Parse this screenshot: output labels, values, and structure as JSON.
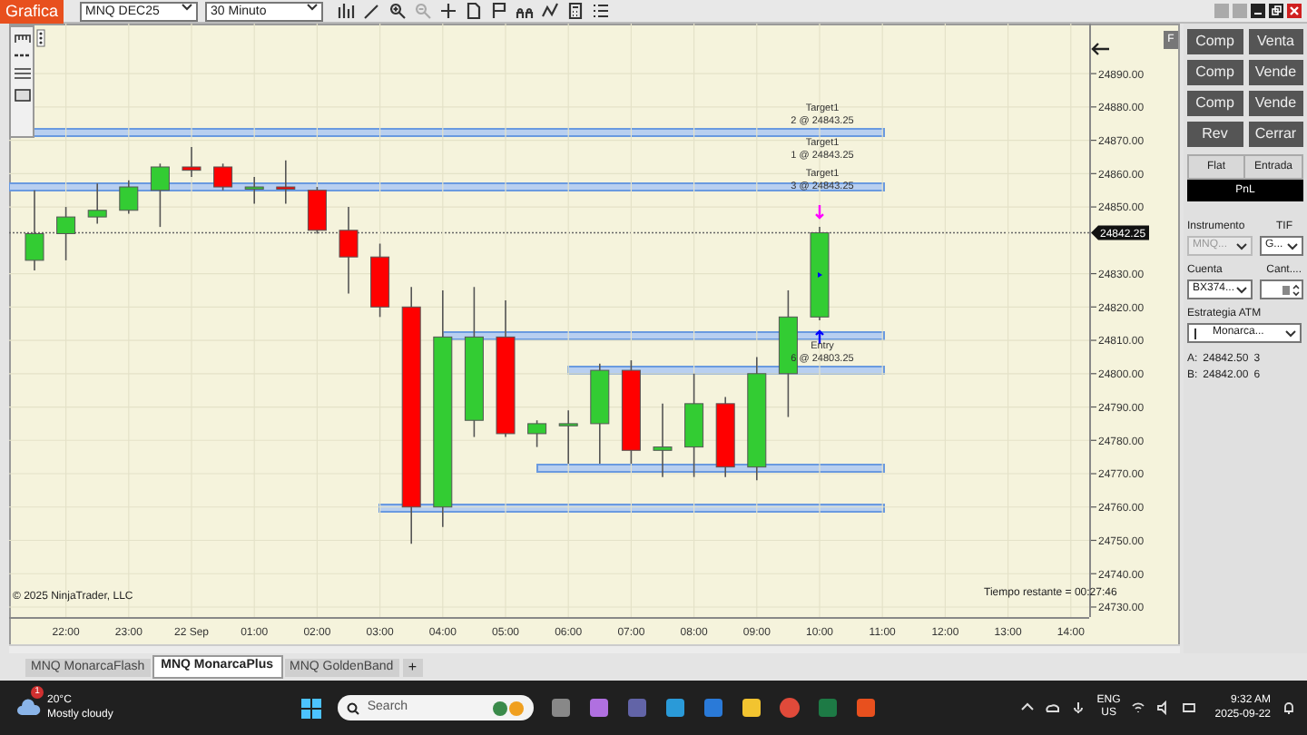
{
  "toolbar": {
    "app_button": "Grafica",
    "instrument": "MNQ DEC25",
    "interval": "30 Minuto"
  },
  "chart": {
    "side_button": "F",
    "copyright": "© 2025 NinjaTrader, LLC",
    "time_remaining": "Tiempo restante = 00:27:46",
    "order_labels": [
      {
        "title": "Target1",
        "detail": "2 @ 24843.25"
      },
      {
        "title": "Target1",
        "detail": "1 @ 24843.25"
      },
      {
        "title": "Target1",
        "detail": "3 @ 24843.25"
      },
      {
        "title": "Entry",
        "detail": "6 @ 24803.25"
      }
    ],
    "chart_data": {
      "type": "candlestick",
      "categories": [
        null,
        "22:00",
        null,
        "23:00",
        null,
        "22 Sep",
        null,
        "01:00",
        null,
        "02:00",
        null,
        "03:00",
        null,
        "04:00",
        null,
        "05:00",
        null,
        "06:00",
        null,
        "07:00",
        null,
        "08:00",
        null,
        "09:00",
        null,
        "10:00",
        null,
        "11:00",
        null,
        "12:00",
        null,
        "13:00",
        null,
        "14:00"
      ],
      "ohlc": [
        [
          24834,
          24855,
          24831,
          24842
        ],
        [
          24842,
          24850,
          24834,
          24847
        ],
        [
          24847,
          24857,
          24845,
          24849
        ],
        [
          24849,
          24858,
          24848,
          24856
        ],
        [
          24855,
          24863,
          24844,
          24862
        ],
        [
          24862,
          24868,
          24859,
          24861
        ],
        [
          24862,
          24863,
          24855,
          24856
        ],
        [
          24856,
          24859,
          24851,
          24856
        ],
        [
          24856,
          24864,
          24851,
          24855.5
        ],
        [
          24855,
          24856,
          24842,
          24843
        ],
        [
          24843,
          24850,
          24824,
          24835
        ],
        [
          24835,
          24839,
          24817,
          24820
        ],
        [
          24820,
          24826,
          24749,
          24760
        ],
        [
          24760,
          24825,
          24754,
          24811
        ],
        [
          24786,
          24826,
          24781,
          24811
        ],
        [
          24811,
          24822,
          24781,
          24782
        ],
        [
          24782,
          24786,
          24778,
          24785
        ],
        [
          24785,
          24789,
          24773,
          24785
        ],
        [
          24785,
          24803,
          24773,
          24801
        ],
        [
          24801,
          24804,
          24773,
          24777
        ],
        [
          24777,
          24791,
          24769,
          24778
        ],
        [
          24778,
          24800,
          24769,
          24791
        ],
        [
          24791,
          24793,
          24769,
          24772
        ],
        [
          24772,
          24805,
          24768,
          24800
        ],
        [
          24800,
          24825,
          24787,
          24817
        ],
        [
          24817,
          24844,
          24816,
          24842.25
        ],
        null,
        null,
        null,
        null,
        null,
        null,
        null,
        null
      ],
      "ylim": [
        24727,
        24905
      ],
      "yticks": [
        {
          "value": 24890,
          "label": "24890.00"
        },
        {
          "value": 24880,
          "label": "24880.00"
        },
        {
          "value": 24870,
          "label": "24870.00"
        },
        {
          "value": 24860,
          "label": "24860.00"
        },
        {
          "value": 24850,
          "label": "24850.00"
        },
        {
          "value": 24830,
          "label": "24830.00"
        },
        {
          "value": 24820,
          "label": "24820.00"
        },
        {
          "value": 24810,
          "label": "24810.00"
        },
        {
          "value": 24800,
          "label": "24800.00"
        },
        {
          "value": 24790,
          "label": "24790.00"
        },
        {
          "value": 24780,
          "label": "24780.00"
        },
        {
          "value": 24770,
          "label": "24770.00"
        },
        {
          "value": 24760,
          "label": "24760.00"
        },
        {
          "value": 24750,
          "label": "24750.00"
        },
        {
          "value": 24740,
          "label": "24740.00"
        },
        {
          "value": 24730,
          "label": "24730.00"
        }
      ],
      "grid": true
    },
    "price_tag": "24842.25"
  },
  "order_panel": {
    "buttons": [
      {
        "label": "Comp"
      },
      {
        "label": "Venta"
      },
      {
        "label": "Comp"
      },
      {
        "label": "Vende"
      },
      {
        "label": "Comp"
      },
      {
        "label": "Vende"
      },
      {
        "label": "Rev"
      },
      {
        "label": "Cerrar"
      }
    ],
    "flat": "Flat",
    "entry": "Entrada",
    "pnl": "PnL",
    "instrument_label": "Instrumento",
    "tif_label": "TIF",
    "instrument": {
      "value": "MNQ...",
      "disabled": true
    },
    "tif": {
      "value": "G...",
      "disabled": false
    },
    "account_label": "Cuenta",
    "qty_label": "Cant....",
    "account": "BX374...",
    "atm_label": "Estrategia ATM",
    "atm": "Monarca...",
    "quotes": [
      {
        "side": "A:",
        "price": "24842.50",
        "size": "3"
      },
      {
        "side": "B:",
        "price": "24842.00",
        "size": "6"
      }
    ]
  },
  "tabs": [
    {
      "label": "MNQ MonarcaFlash",
      "selected": false
    },
    {
      "label": "MNQ MonarcaPlus",
      "selected": true
    },
    {
      "label": "MNQ GoldenBand",
      "selected": false
    }
  ],
  "add_tab": "+",
  "taskbar": {
    "weather_badge": "1",
    "temperature": "20°C",
    "weather": "Mostly cloudy",
    "search_placeholder": "Search",
    "language": "ENG",
    "region": "US",
    "time": "9:32 AM",
    "date": "2025-09-22"
  }
}
